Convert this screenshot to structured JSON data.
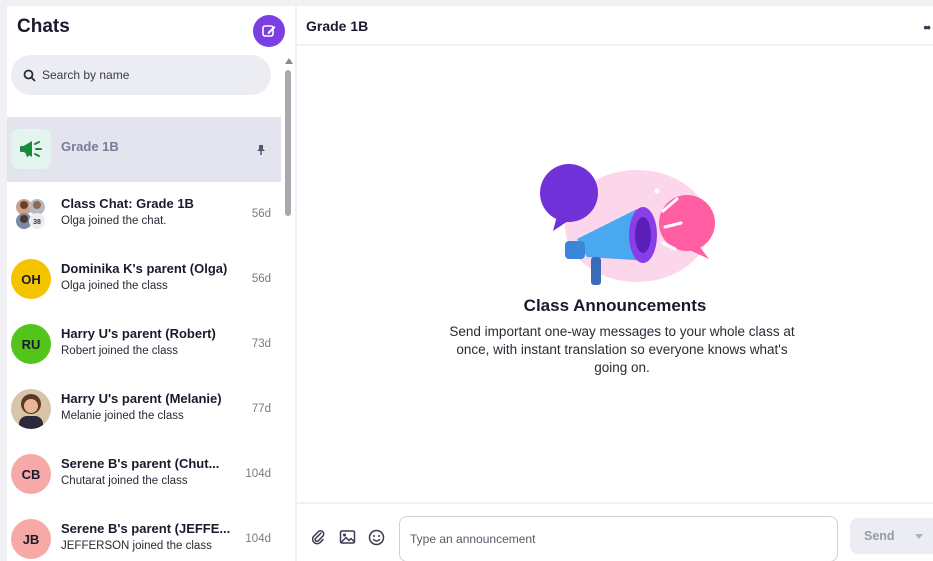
{
  "sidebar": {
    "title": "Chats",
    "search_placeholder": "Search by name",
    "chats": [
      {
        "name": "Grade 1B",
        "preview": "",
        "time": "",
        "avatar": "megaphone-icon",
        "active": true,
        "pinned": true
      },
      {
        "name": "Class Chat: Grade 1B",
        "preview": "Olga joined the chat.",
        "time": "56d",
        "avatar": "group-photo",
        "avatar_badge": "38"
      },
      {
        "name": "Dominika K's parent (Olga)",
        "preview": "Olga joined the class",
        "time": "56d",
        "avatar_initials": "OH",
        "avatar_color": "#f5c400"
      },
      {
        "name": "Harry U's parent (Robert)",
        "preview": "Robert joined the class",
        "time": "73d",
        "avatar_initials": "RU",
        "avatar_color": "#52c41a"
      },
      {
        "name": "Harry U's parent (Melanie)",
        "preview": "Melanie joined the class",
        "time": "77d",
        "avatar": "profile-photo"
      },
      {
        "name": "Serene B's parent (Chut...",
        "preview": "Chutarat joined the class",
        "time": "104d",
        "avatar_initials": "CB",
        "avatar_color": "#f7a9a8"
      },
      {
        "name": "Serene B's parent (JEFFE...",
        "preview": "JEFFERSON joined the class",
        "time": "104d",
        "avatar_initials": "JB",
        "avatar_color": "#f7a9a8"
      }
    ]
  },
  "main": {
    "title": "Grade 1B",
    "empty_state": {
      "title": "Class Announcements",
      "description": "Send important one-way messages to your whole class at once, with instant translation so everyone knows what's going on."
    },
    "composer": {
      "placeholder": "Type an announcement",
      "send_label": "Send"
    }
  },
  "colors": {
    "accent": "#7b3fe4",
    "active_row": "#e4e4ee",
    "pink": "#ff5fa2",
    "blue": "#3aa8f0"
  }
}
